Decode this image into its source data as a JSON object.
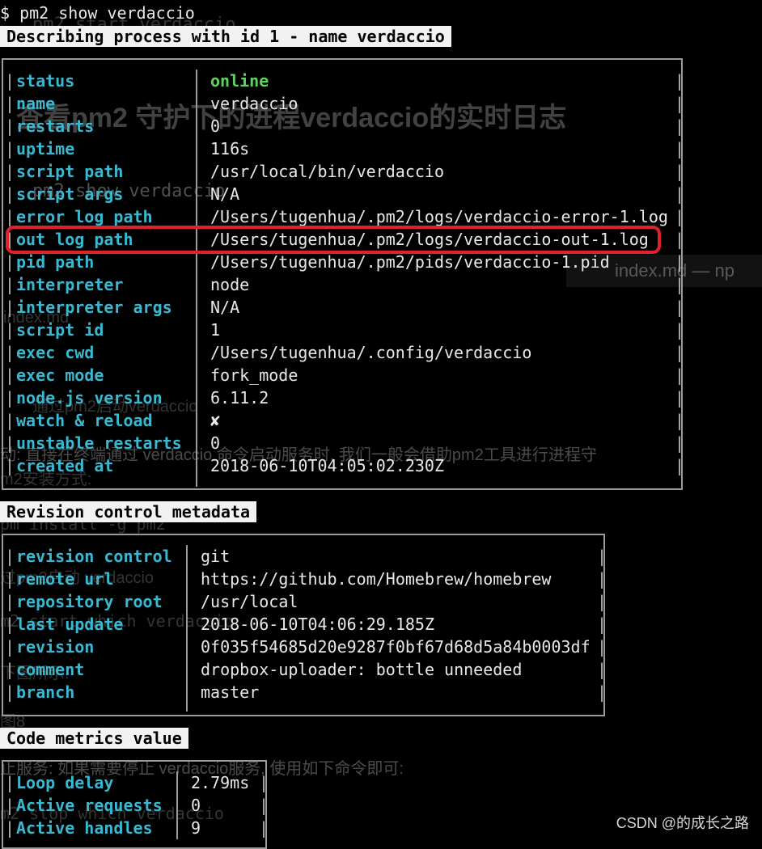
{
  "command": "$ pm2 show verdaccio",
  "sections": {
    "process_header": "Describing process with id 1 - name verdaccio",
    "revision_header": "Revision control metadata",
    "metrics_header": "Code metrics value"
  },
  "process": [
    {
      "key": "status",
      "value": "online"
    },
    {
      "key": "name",
      "value": "verdaccio"
    },
    {
      "key": "restarts",
      "value": "0"
    },
    {
      "key": "uptime",
      "value": "116s"
    },
    {
      "key": "script path",
      "value": "/usr/local/bin/verdaccio"
    },
    {
      "key": "script args",
      "value": "N/A"
    },
    {
      "key": "error log path",
      "value": "/Users/tugenhua/.pm2/logs/verdaccio-error-1.log"
    },
    {
      "key": "out log path",
      "value": "/Users/tugenhua/.pm2/logs/verdaccio-out-1.log"
    },
    {
      "key": "pid path",
      "value": "/Users/tugenhua/.pm2/pids/verdaccio-1.pid"
    },
    {
      "key": "interpreter",
      "value": "node"
    },
    {
      "key": "interpreter args",
      "value": "N/A"
    },
    {
      "key": "script id",
      "value": "1"
    },
    {
      "key": "exec cwd",
      "value": "/Users/tugenhua/.config/verdaccio"
    },
    {
      "key": "exec mode",
      "value": "fork_mode"
    },
    {
      "key": "node.js version",
      "value": "6.11.2"
    },
    {
      "key": "watch & reload",
      "value": "✘"
    },
    {
      "key": "unstable restarts",
      "value": "0"
    },
    {
      "key": "created at",
      "value": "2018-06-10T04:05:02.230Z"
    }
  ],
  "revision": [
    {
      "key": "revision control",
      "value": "git"
    },
    {
      "key": "remote url",
      "value": "https://github.com/Homebrew/homebrew"
    },
    {
      "key": "repository root",
      "value": "/usr/local"
    },
    {
      "key": "last update",
      "value": "2018-06-10T04:06:29.185Z"
    },
    {
      "key": "revision",
      "value": "0f035f54685d20e9287f0bf67d68d5a84b0003df"
    },
    {
      "key": "comment",
      "value": "dropbox-uploader: bottle unneeded"
    },
    {
      "key": "branch",
      "value": "master"
    }
  ],
  "metrics": [
    {
      "key": "Loop delay",
      "value": "2.79ms"
    },
    {
      "key": "Active requests",
      "value": "0"
    },
    {
      "key": "Active handles",
      "value": "9"
    }
  ],
  "background": {
    "g1": "pm2 start verdaccio",
    "g2": "查看pm2 守护下的进程verdaccio的实时日志",
    "g3": "pm2 show verdaccio",
    "g4": "index.md — np",
    "g5": "index.md",
    "g6": "通过pm2启动verdaccio",
    "g7": "动: 直接在终端通过 verdaccio 命令启动服务时, 我们一般会借助pm2工具进行进程守",
    "g8": "m2安装方式:",
    "g9": "pm install -g pm2",
    "g10": "过pm2启动 verdaccio",
    "g11": "m2 start which verdaccio",
    "g12": "下图所示:",
    "g13": "图8",
    "g14": "止服务: 如果需要停止 verdaccio服务, 使用如下命令即可:",
    "g15": "m2 stop which verdaccio"
  },
  "watermark": "CSDN @的成长之路",
  "colors": {
    "key": "#3bb8d0",
    "online": "#5fd35f",
    "highlight": "#e0222a",
    "border": "#9a9a9a"
  }
}
